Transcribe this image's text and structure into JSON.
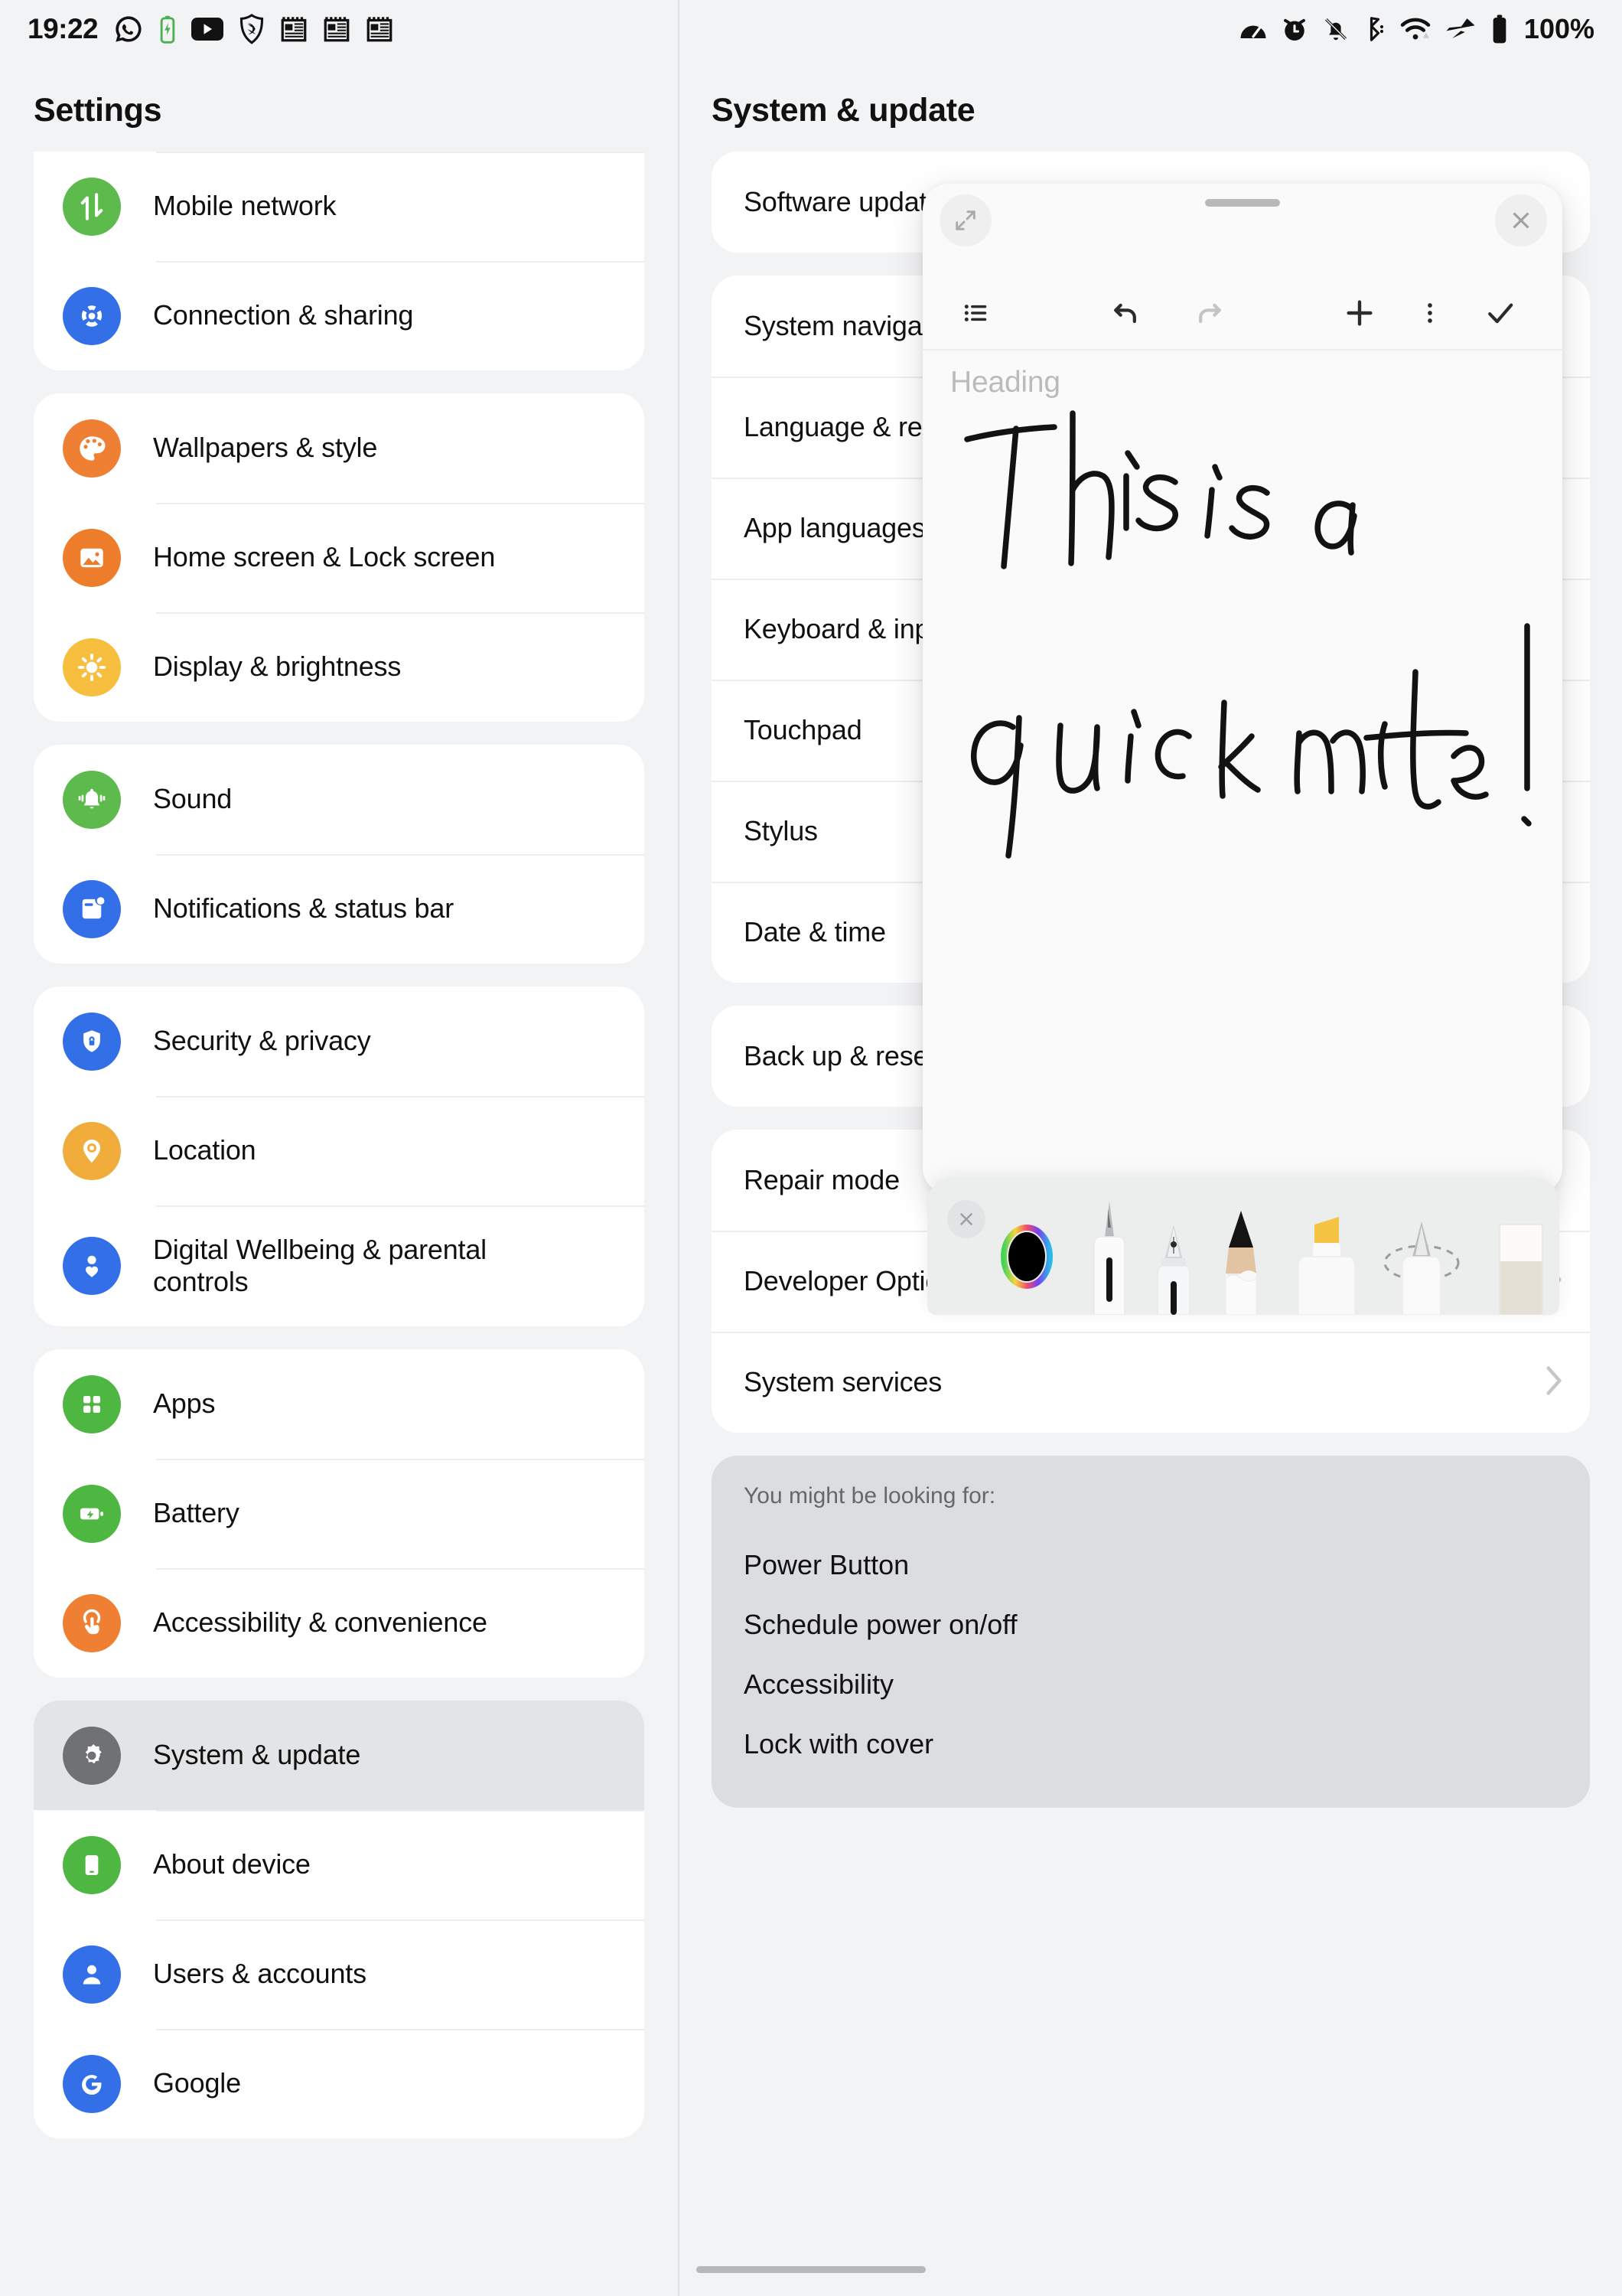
{
  "status_bar": {
    "time": "19:22",
    "left_icons": [
      "whatsapp-icon",
      "battery-charging-icon",
      "youtube-icon",
      "shield-icon",
      "note-icon",
      "note-icon",
      "note-icon"
    ],
    "right_icons": [
      "speedometer-icon",
      "alarm-clock-icon",
      "bell-off-icon",
      "bluetooth-icon",
      "wifi-icon",
      "airplane-mode-icon",
      "battery-full-icon"
    ],
    "battery_percent": "100%"
  },
  "colors": {
    "page_bg": "#f2f3f5",
    "card_bg": "#ffffff",
    "selected_row": "#e3e4e6",
    "suggest_bg": "#dcdde0",
    "green": "#5cbb4c",
    "blue": "#3370e8",
    "orange": "#ef8033",
    "orange_dark": "#ed7d2b",
    "amber": "#f5b63d",
    "yellow": "#f7bd3f",
    "grey_icon": "#6f7174",
    "ink": "#121212",
    "highlighter_yellow": "#f6c443"
  },
  "sidebar": {
    "title": "Settings",
    "groups": [
      {
        "items": [
          {
            "label": "Mobile network",
            "icon": "mobile-network-icon",
            "color": "#5cbb4c"
          },
          {
            "label": "Connection & sharing",
            "icon": "connection-sharing-icon",
            "color": "#3370e8"
          }
        ]
      },
      {
        "items": [
          {
            "label": "Wallpapers & style",
            "icon": "palette-icon",
            "color": "#ef8033"
          },
          {
            "label": "Home screen & Lock screen",
            "icon": "image-icon",
            "color": "#ed7d2b"
          },
          {
            "label": "Display & brightness",
            "icon": "sun-icon",
            "color": "#f7bd3f"
          }
        ]
      },
      {
        "items": [
          {
            "label": "Sound",
            "icon": "bell-icon",
            "color": "#5cbb4c"
          },
          {
            "label": "Notifications & status bar",
            "icon": "notification-icon",
            "color": "#3370e8"
          }
        ]
      },
      {
        "items": [
          {
            "label": "Security & privacy",
            "icon": "shield-lock-icon",
            "color": "#3370e8"
          },
          {
            "label": "Location",
            "icon": "location-pin-icon",
            "color": "#f0ad3c"
          },
          {
            "label": "Digital Wellbeing & parental controls",
            "icon": "person-heart-icon",
            "color": "#3370e8"
          }
        ]
      },
      {
        "items": [
          {
            "label": "Apps",
            "icon": "apps-grid-icon",
            "color": "#4eb741"
          },
          {
            "label": "Battery",
            "icon": "battery-charging-icon",
            "color": "#4eb741"
          },
          {
            "label": "Accessibility & convenience",
            "icon": "touch-hand-icon",
            "color": "#ef8033"
          }
        ]
      },
      {
        "items": [
          {
            "label": "System & update",
            "icon": "gear-icon",
            "color": "#6f7174",
            "selected": true
          },
          {
            "label": "About device",
            "icon": "phone-icon",
            "color": "#4eb741"
          },
          {
            "label": "Users & accounts",
            "icon": "person-icon",
            "color": "#3370e8"
          },
          {
            "label": "Google",
            "icon": "google-g-icon",
            "color": "#3370e8"
          }
        ]
      }
    ]
  },
  "main": {
    "title": "System & update",
    "cards": [
      {
        "rows": [
          {
            "label": "Software update",
            "chevron": false
          }
        ]
      },
      {
        "rows": [
          {
            "label": "System navigation",
            "chevron": false
          },
          {
            "label": "Language & region",
            "chevron": false
          },
          {
            "label": "App languages",
            "chevron": false
          },
          {
            "label": "Keyboard & input method",
            "chevron": false
          },
          {
            "label": "Touchpad",
            "chevron": false
          },
          {
            "label": "Stylus",
            "chevron": false
          },
          {
            "label": "Date & time",
            "chevron": false
          }
        ]
      },
      {
        "rows": [
          {
            "label": "Back up & reset",
            "chevron": false
          }
        ]
      },
      {
        "rows": [
          {
            "label": "Repair mode",
            "chevron": false
          },
          {
            "label": "Developer Options",
            "chevron": true
          },
          {
            "label": "System services",
            "chevron": true
          }
        ]
      }
    ],
    "suggestions": {
      "title": "You might be looking for:",
      "items": [
        "Power Button",
        "Schedule power on/off",
        "Accessibility",
        "Lock with cover"
      ]
    }
  },
  "note_window": {
    "expand_icon": "expand-arrows-icon",
    "drag_handle": "drag-handle",
    "close_icon": "close-icon",
    "toolbar_icons": [
      "list-icon",
      "undo-icon",
      "redo-icon",
      "plus-icon",
      "more-vertical-icon",
      "check-icon"
    ],
    "heading_placeholder": "Heading",
    "handwriting_text": "This is a quick note!"
  },
  "pen_tray": {
    "close_icon": "close-icon",
    "tools": [
      {
        "name": "color-wheel-picker",
        "selected_color": "#000000"
      },
      {
        "name": "ballpoint-pen-tool"
      },
      {
        "name": "fountain-pen-tool"
      },
      {
        "name": "pencil-tool"
      },
      {
        "name": "highlighter-tool"
      },
      {
        "name": "brush-marker-tool"
      },
      {
        "name": "eraser-tool"
      }
    ]
  }
}
